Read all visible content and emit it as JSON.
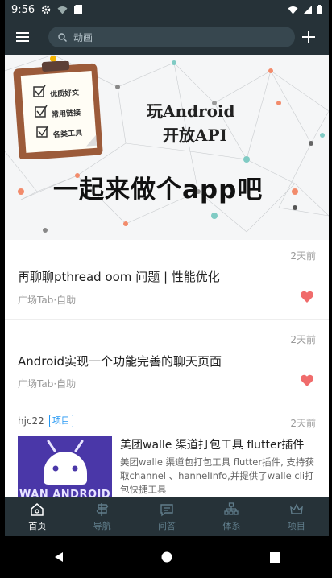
{
  "statusbar": {
    "time": "9:56"
  },
  "appbar": {
    "search_placeholder": "动画"
  },
  "banner": {
    "title_line1": "玩Android",
    "title_line2": "开放API",
    "slogan": "一起来做个app吧",
    "checklist": [
      "优质好文",
      "常用链接",
      "各类工具"
    ]
  },
  "articles": [
    {
      "time": "2天前",
      "title": "再聊聊pthread oom 问题 | 性能优化",
      "meta": "广场Tab·自助",
      "liked": true
    },
    {
      "time": "2天前",
      "title": "Android实现一个功能完善的聊天页面",
      "meta": "广场Tab·自助",
      "liked": true
    }
  ],
  "project": {
    "author": "hjc22",
    "tag": "项目",
    "time": "2天前",
    "thumb_text": "WAN ANDROID",
    "title": "美团walle 渠道打包工具 flutter插件",
    "desc": "美团walle 渠道包打包工具 flutter插件, 支持获取channel 、hannelInfo,并提供了walle cli打包快捷工具"
  },
  "bottom_nav": [
    {
      "label": "首页",
      "active": true
    },
    {
      "label": "导航",
      "active": false
    },
    {
      "label": "问答",
      "active": false
    },
    {
      "label": "体系",
      "active": false
    },
    {
      "label": "项目",
      "active": false
    }
  ],
  "colors": {
    "appbar": "#263238",
    "heart": "#F06C6C",
    "tag": "#2196F3"
  }
}
